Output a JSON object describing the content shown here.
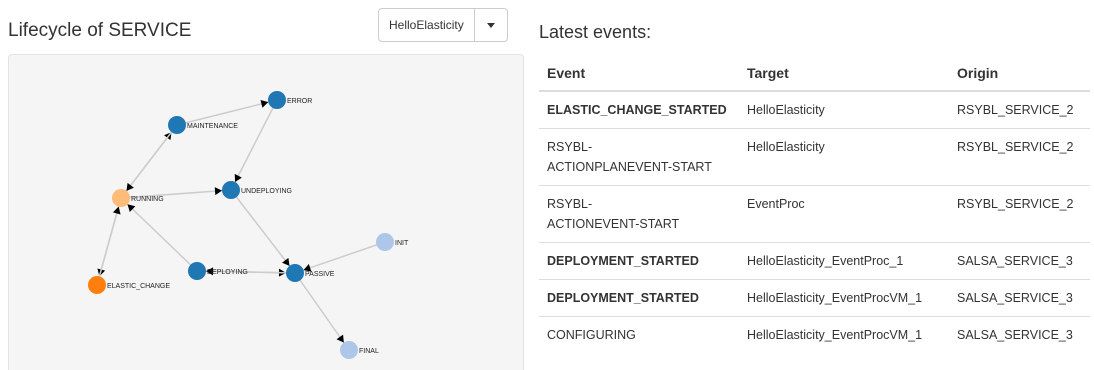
{
  "lifecycle": {
    "title": "Lifecycle of SERVICE",
    "service_select": {
      "value": "HelloElasticity"
    },
    "nodes": [
      {
        "id": "error",
        "label": "ERROR",
        "color": "#1f77b4"
      },
      {
        "id": "maintenance",
        "label": "MAINTENANCE",
        "color": "#1f77b4"
      },
      {
        "id": "running",
        "label": "RUNNING",
        "color": "#ffbb78"
      },
      {
        "id": "undeploying",
        "label": "UNDEPLOYING",
        "color": "#1f77b4"
      },
      {
        "id": "init",
        "label": "INIT",
        "color": "#aec7e8"
      },
      {
        "id": "deploying",
        "label": "DEPLOYING",
        "color": "#1f77b4"
      },
      {
        "id": "passive",
        "label": "PASSIVE",
        "color": "#1f77b4"
      },
      {
        "id": "elastic_change",
        "label": "ELASTIC_CHANGE",
        "color": "#ff7f0e"
      },
      {
        "id": "final",
        "label": "FINAL",
        "color": "#aec7e8"
      }
    ],
    "edges": [
      {
        "from": "maintenance",
        "to": "error"
      },
      {
        "from": "error",
        "to": "undeploying"
      },
      {
        "from": "running",
        "to": "maintenance"
      },
      {
        "from": "maintenance",
        "to": "running"
      },
      {
        "from": "running",
        "to": "undeploying"
      },
      {
        "from": "running",
        "to": "elastic_change"
      },
      {
        "from": "elastic_change",
        "to": "running"
      },
      {
        "from": "deploying",
        "to": "running"
      },
      {
        "from": "deploying",
        "to": "passive"
      },
      {
        "from": "passive",
        "to": "deploying"
      },
      {
        "from": "undeploying",
        "to": "passive"
      },
      {
        "from": "init",
        "to": "passive"
      },
      {
        "from": "passive",
        "to": "final"
      }
    ]
  },
  "events": {
    "title": "Latest events:",
    "columns": {
      "event": "Event",
      "target": "Target",
      "origin": "Origin"
    },
    "rows": [
      {
        "event": "ELASTIC_CHANGE_STARTED",
        "bold": true,
        "target": "HelloElasticity",
        "origin": "RSYBL_SERVICE_2"
      },
      {
        "event": "RSYBL-\nACTIONPLANEVENT-START",
        "bold": false,
        "target": "HelloElasticity",
        "origin": "RSYBL_SERVICE_2"
      },
      {
        "event": "RSYBL-\nACTIONEVENT-START",
        "bold": false,
        "target": "EventProc",
        "origin": "RSYBL_SERVICE_2"
      },
      {
        "event": "DEPLOYMENT_STARTED",
        "bold": true,
        "target": "HelloElasticity_EventProc_1",
        "origin": "SALSA_SERVICE_3"
      },
      {
        "event": "DEPLOYMENT_STARTED",
        "bold": true,
        "target": "HelloElasticity_EventProcVM_1",
        "origin": "SALSA_SERVICE_3"
      },
      {
        "event": "CONFIGURING",
        "bold": false,
        "target": "HelloElasticity_EventProcVM_1",
        "origin": "SALSA_SERVICE_3"
      }
    ]
  }
}
